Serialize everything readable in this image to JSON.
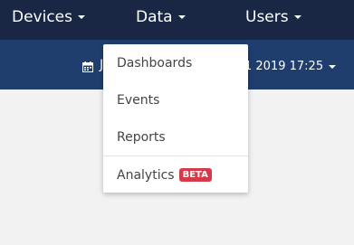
{
  "nav": {
    "items": [
      {
        "label": "Devices"
      },
      {
        "label": "Data"
      },
      {
        "label": "Users"
      }
    ]
  },
  "subbar": {
    "date_left": "J",
    "date_right": "1 2019 17:25"
  },
  "dropdown": {
    "items": [
      {
        "label": "Dashboards"
      },
      {
        "label": "Events"
      },
      {
        "label": "Reports"
      },
      {
        "label": "Analytics",
        "badge": "BETA"
      }
    ]
  },
  "colors": {
    "nav_bg": "#1a2744",
    "subbar_bg": "#1f3e6e",
    "badge_red": "#d63a4a",
    "page_bg": "#f2f2f2"
  },
  "icons": {
    "calendar": "calendar-icon",
    "caret": "caret-down-icon"
  }
}
